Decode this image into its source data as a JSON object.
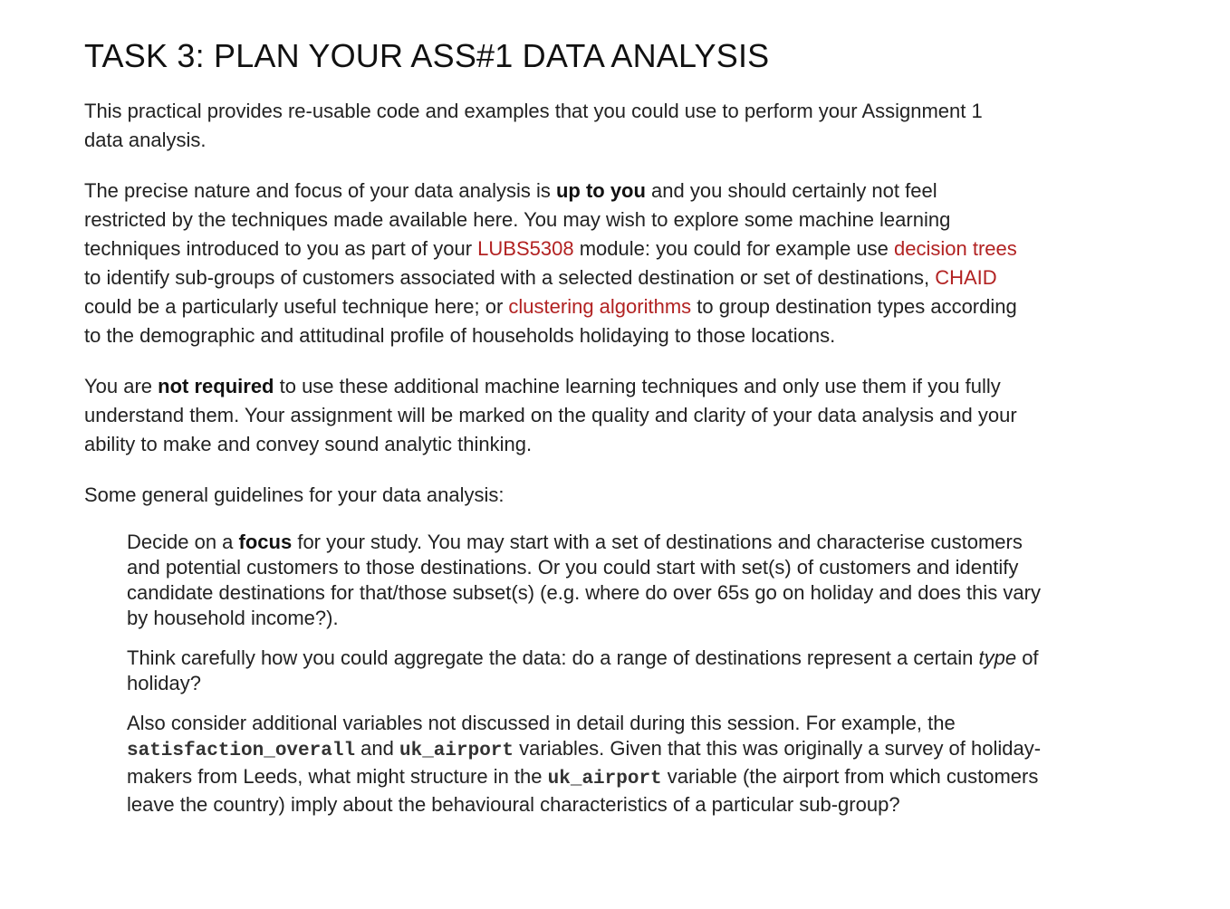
{
  "title": "TASK 3: PLAN YOUR ASS#1 DATA ANALYSIS",
  "para1": {
    "text": "This practical provides re-usable code and examples that you could use to perform your Assignment 1 data analysis."
  },
  "para2": {
    "t1": "The precise nature and focus of your data analysis is ",
    "b1": "up to you",
    "t2": " and you should certainly not feel restricted by the techniques made available here. You may wish to explore some machine learning techniques introduced to you as part of your ",
    "link1": "LUBS5308",
    "t3": " module: you could for example use ",
    "link2": "decision trees",
    "t4": " to identify sub-groups of customers associated with a selected destination or set of destinations, ",
    "link3": "CHAID",
    "t5": " could be a particularly useful technique here; or ",
    "link4": "clustering algorithms",
    "t6": " to group destination types according to the demographic and attitudinal profile of households holidaying to those locations."
  },
  "para3": {
    "t1": "You are ",
    "b1": "not required",
    "t2": " to use these additional machine learning techniques and only use them if you fully understand them. Your assignment will be marked on the quality and clarity of your data analysis and your ability to make and convey sound analytic thinking."
  },
  "para4": {
    "text": "Some general guidelines for your data analysis:"
  },
  "guidelines": [
    {
      "t1": "Decide on a ",
      "b1": "focus",
      "t2": " for your study. You may start with a set of destinations and characterise customers and potential customers to those destinations. Or you could start with set(s) of customers and identify candidate destinations for that/those subset(s) (e.g. where do over 65s go on holiday and does this vary by household income?)."
    },
    {
      "t1": "Think carefully how you could aggregate the data: do a range of destinations represent a certain ",
      "em1": "type",
      "t2": " of holiday?"
    },
    {
      "t1": "Also consider additional variables not discussed in detail during this session. For example, the ",
      "code1": "satisfaction_overall",
      "t2": " and ",
      "code2": "uk_airport",
      "t3": " variables. Given that this was originally a survey of holiday-makers from Leeds, what might structure in the ",
      "code3": "uk_airport",
      "t4": " variable (the airport from which customers leave the country) imply about the behavioural characteristics of a particular sub-group?"
    }
  ],
  "colors": {
    "link": "#b22222",
    "text": "#222222"
  }
}
